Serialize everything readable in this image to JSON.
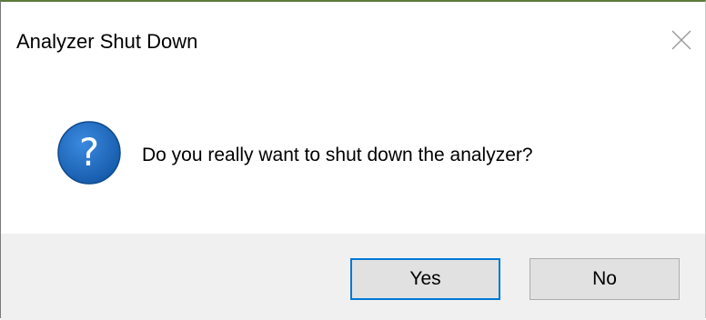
{
  "dialog": {
    "title": "Analyzer Shut Down",
    "message": "Do you really want to shut down the analyzer?",
    "icon": "question-icon",
    "buttons": {
      "yes": "Yes",
      "no": "No"
    },
    "colors": {
      "accent": "#0078d7",
      "icon_blue": "#1a66b8",
      "footer": "#f0f0f0",
      "button": "#e1e1e1"
    }
  }
}
